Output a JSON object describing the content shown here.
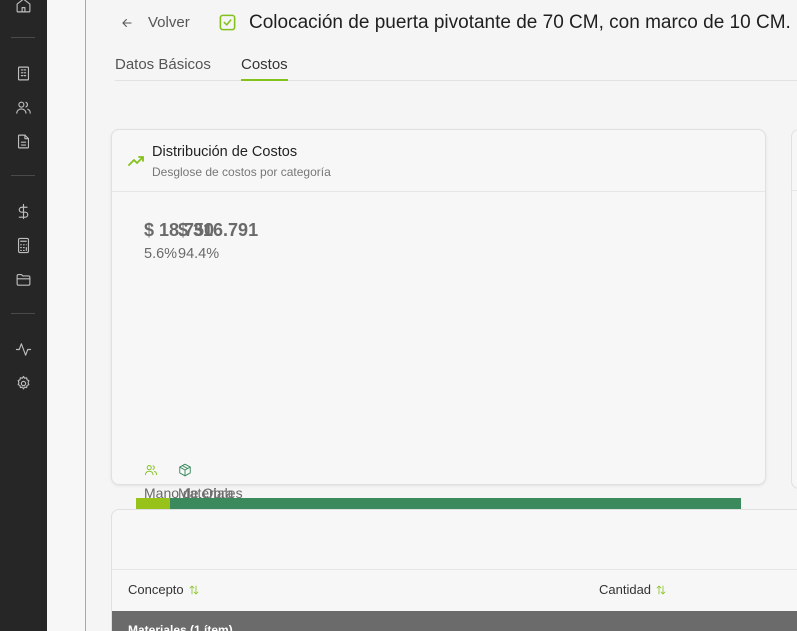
{
  "header": {
    "back_label": "Volver",
    "title": "Colocación de puerta pivotante de 70 CM, con marco de 10 CM."
  },
  "tabs": [
    {
      "label": "Datos Básicos",
      "active": false
    },
    {
      "label": "Costos",
      "active": true
    }
  ],
  "distribution": {
    "title": "Distribución de Costos",
    "subtitle": "Desglose de costos por categoría",
    "items": [
      {
        "label": "Mano de Obra",
        "value": "$ 18.750",
        "percent": "5.6%",
        "icon": "users-icon",
        "share": 5.6,
        "color": "#97c21a"
      },
      {
        "label": "Materiales",
        "value": "$ 316.791",
        "percent": "94.4%",
        "icon": "package-icon",
        "share": 94.4,
        "color": "#3a8a5e"
      }
    ]
  },
  "table": {
    "columns": [
      {
        "label": "Concepto",
        "sortable": true
      },
      {
        "label": "Cantidad",
        "sortable": true
      }
    ],
    "group_label": "Materiales (1 ítem)"
  },
  "colors": {
    "accent": "#84c11b",
    "sidebar": "#262626"
  }
}
